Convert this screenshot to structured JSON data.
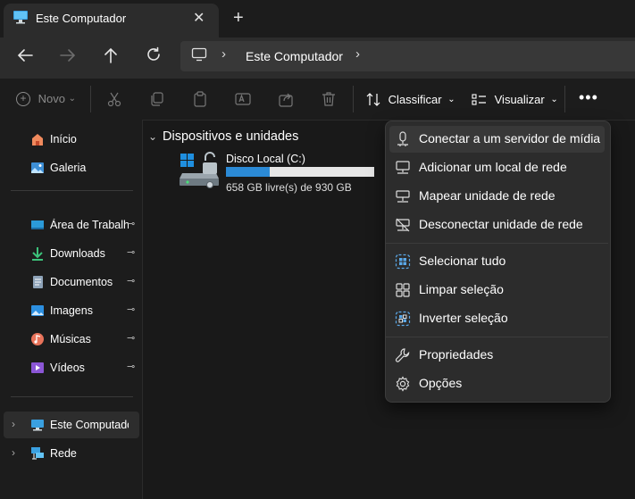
{
  "tab": {
    "title": "Este Computador",
    "close": "✕",
    "new_tab": "+"
  },
  "address": {
    "path": "Este Computador",
    "chevron": "›"
  },
  "toolbar": {
    "new_label": "Novo",
    "sort_label": "Classificar",
    "view_label": "Visualizar",
    "more_label": "•••",
    "dropdown_chevron": "⌄"
  },
  "sidebar": {
    "items": [
      {
        "label": "Início",
        "icon": "home-icon"
      },
      {
        "label": "Galeria",
        "icon": "gallery-icon"
      },
      {
        "label": "Área de Trabalho",
        "icon": "desktop-icon",
        "pinned": true
      },
      {
        "label": "Downloads",
        "icon": "download-icon",
        "pinned": true
      },
      {
        "label": "Documentos",
        "icon": "documents-icon",
        "pinned": true
      },
      {
        "label": "Imagens",
        "icon": "images-icon",
        "pinned": true
      },
      {
        "label": "Músicas",
        "icon": "music-icon",
        "pinned": true
      },
      {
        "label": "Vídeos",
        "icon": "videos-icon",
        "pinned": true
      },
      {
        "label": "Este Computador",
        "icon": "computer-icon",
        "selected": true
      },
      {
        "label": "Rede",
        "icon": "network-icon"
      }
    ],
    "pin_glyph": "📌",
    "expand_glyph": "›"
  },
  "main": {
    "group_title": "Dispositivos e unidades",
    "group_chevron": "⌄",
    "drive": {
      "name": "Disco Local (C:)",
      "space_text": "658 GB livre(s) de 930 GB",
      "used_fraction": 0.2925,
      "bar_color": "#2b8ad6"
    }
  },
  "menu": {
    "items": [
      {
        "label": "Conectar a um servidor de mídia",
        "icon": "media-server-icon"
      },
      {
        "label": "Adicionar um local de rede",
        "icon": "network-location-icon"
      },
      {
        "label": "Mapear unidade de rede",
        "icon": "map-drive-icon"
      },
      {
        "label": "Desconectar unidade de rede",
        "icon": "disconnect-drive-icon"
      },
      {
        "label": "Selecionar tudo",
        "icon": "select-all-icon"
      },
      {
        "label": "Limpar seleção",
        "icon": "clear-selection-icon"
      },
      {
        "label": "Inverter seleção",
        "icon": "invert-selection-icon"
      },
      {
        "label": "Propriedades",
        "icon": "wrench-icon"
      },
      {
        "label": "Opções",
        "icon": "gear-icon"
      }
    ]
  },
  "colors": {
    "accent": "#4cc2ff",
    "background": "#191919",
    "menu": "#2c2c2c"
  }
}
